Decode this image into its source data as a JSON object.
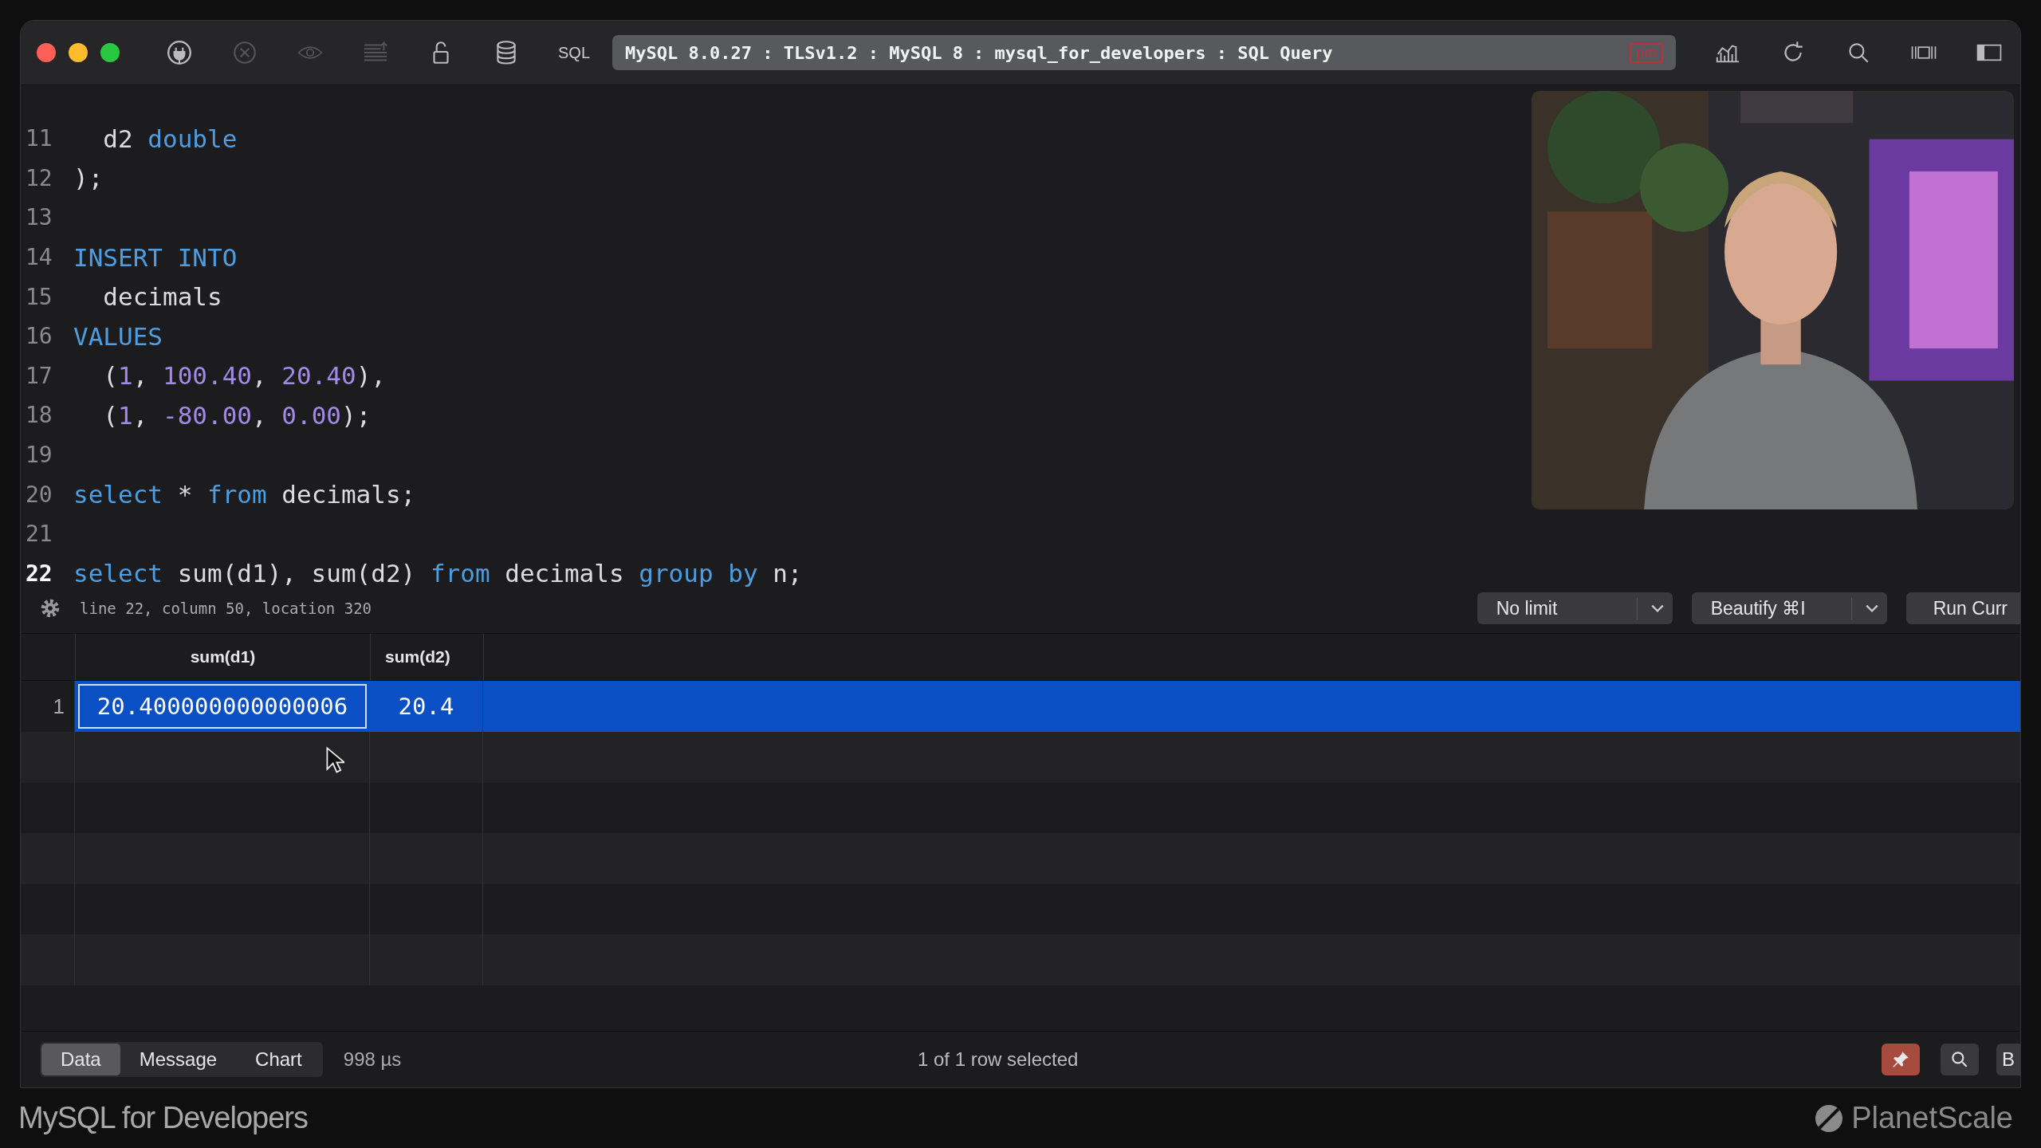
{
  "toolbar": {
    "sql_label": "SQL",
    "connection": "MySQL 8.0.27 : TLSv1.2 : MySQL 8 : mysql_for_developers : SQL Query",
    "badge": "pro"
  },
  "editor": {
    "lines": [
      {
        "number": "11",
        "current": false,
        "tokens": [
          {
            "kind": "plain",
            "text": "  d2 "
          },
          {
            "kind": "keyword",
            "text": "double"
          }
        ]
      },
      {
        "number": "12",
        "current": false,
        "tokens": [
          {
            "kind": "plain",
            "text": ");"
          }
        ]
      },
      {
        "number": "13",
        "current": false
      },
      {
        "number": "14",
        "current": false,
        "tokens": [
          {
            "kind": "keyword",
            "text": "INSERT INTO"
          }
        ]
      },
      {
        "number": "15",
        "current": false,
        "tokens": [
          {
            "kind": "plain",
            "text": "  decimals"
          }
        ]
      },
      {
        "number": "16",
        "current": false,
        "tokens": [
          {
            "kind": "keyword",
            "text": "VALUES"
          }
        ]
      },
      {
        "number": "17",
        "current": false,
        "tokens": [
          {
            "kind": "plain",
            "text": "  ("
          },
          {
            "kind": "number",
            "text": "1"
          },
          {
            "kind": "plain",
            "text": ", "
          },
          {
            "kind": "number",
            "text": "100.40"
          },
          {
            "kind": "plain",
            "text": ", "
          },
          {
            "kind": "number",
            "text": "20.40"
          },
          {
            "kind": "plain",
            "text": "),"
          }
        ]
      },
      {
        "number": "18",
        "current": false,
        "tokens": [
          {
            "kind": "plain",
            "text": "  ("
          },
          {
            "kind": "number",
            "text": "1"
          },
          {
            "kind": "plain",
            "text": ", "
          },
          {
            "kind": "number",
            "text": "-80.00"
          },
          {
            "kind": "plain",
            "text": ", "
          },
          {
            "kind": "number",
            "text": "0.00"
          },
          {
            "kind": "plain",
            "text": ");"
          }
        ]
      },
      {
        "number": "19",
        "current": false
      },
      {
        "number": "20",
        "current": false,
        "tokens": [
          {
            "kind": "keyword",
            "text": "select"
          },
          {
            "kind": "plain",
            "text": " * "
          },
          {
            "kind": "keyword",
            "text": "from"
          },
          {
            "kind": "plain",
            "text": " decimals;"
          }
        ]
      },
      {
        "number": "21",
        "current": false
      },
      {
        "number": "22",
        "current": true,
        "tokens": [
          {
            "kind": "keyword",
            "text": "select"
          },
          {
            "kind": "plain",
            "text": " sum(d1), sum(d2) "
          },
          {
            "kind": "keyword",
            "text": "from"
          },
          {
            "kind": "plain",
            "text": " decimals "
          },
          {
            "kind": "keyword",
            "text": "group by"
          },
          {
            "kind": "plain",
            "text": " n;"
          }
        ]
      }
    ]
  },
  "status": {
    "position": "line 22, column 50, location 320",
    "limit": "No limit",
    "beautify": "Beautify ⌘I",
    "run": "Run Curr"
  },
  "results": {
    "columns": [
      "sum(d1)",
      "sum(d2)"
    ],
    "rows": [
      {
        "number": "1",
        "selected": true,
        "cells": [
          "20.400000000000006",
          "20.4"
        ]
      }
    ]
  },
  "bottom_bar": {
    "tabs": [
      {
        "label": "Data",
        "selected": true
      },
      {
        "label": "Message",
        "selected": false
      },
      {
        "label": "Chart",
        "selected": false
      }
    ],
    "timing": "998 µs",
    "selection": "1 of 1 row selected",
    "pin_on": true,
    "last_button": "B"
  },
  "footer": {
    "course": "MySQL for Developers",
    "brand": "PlanetScale"
  }
}
